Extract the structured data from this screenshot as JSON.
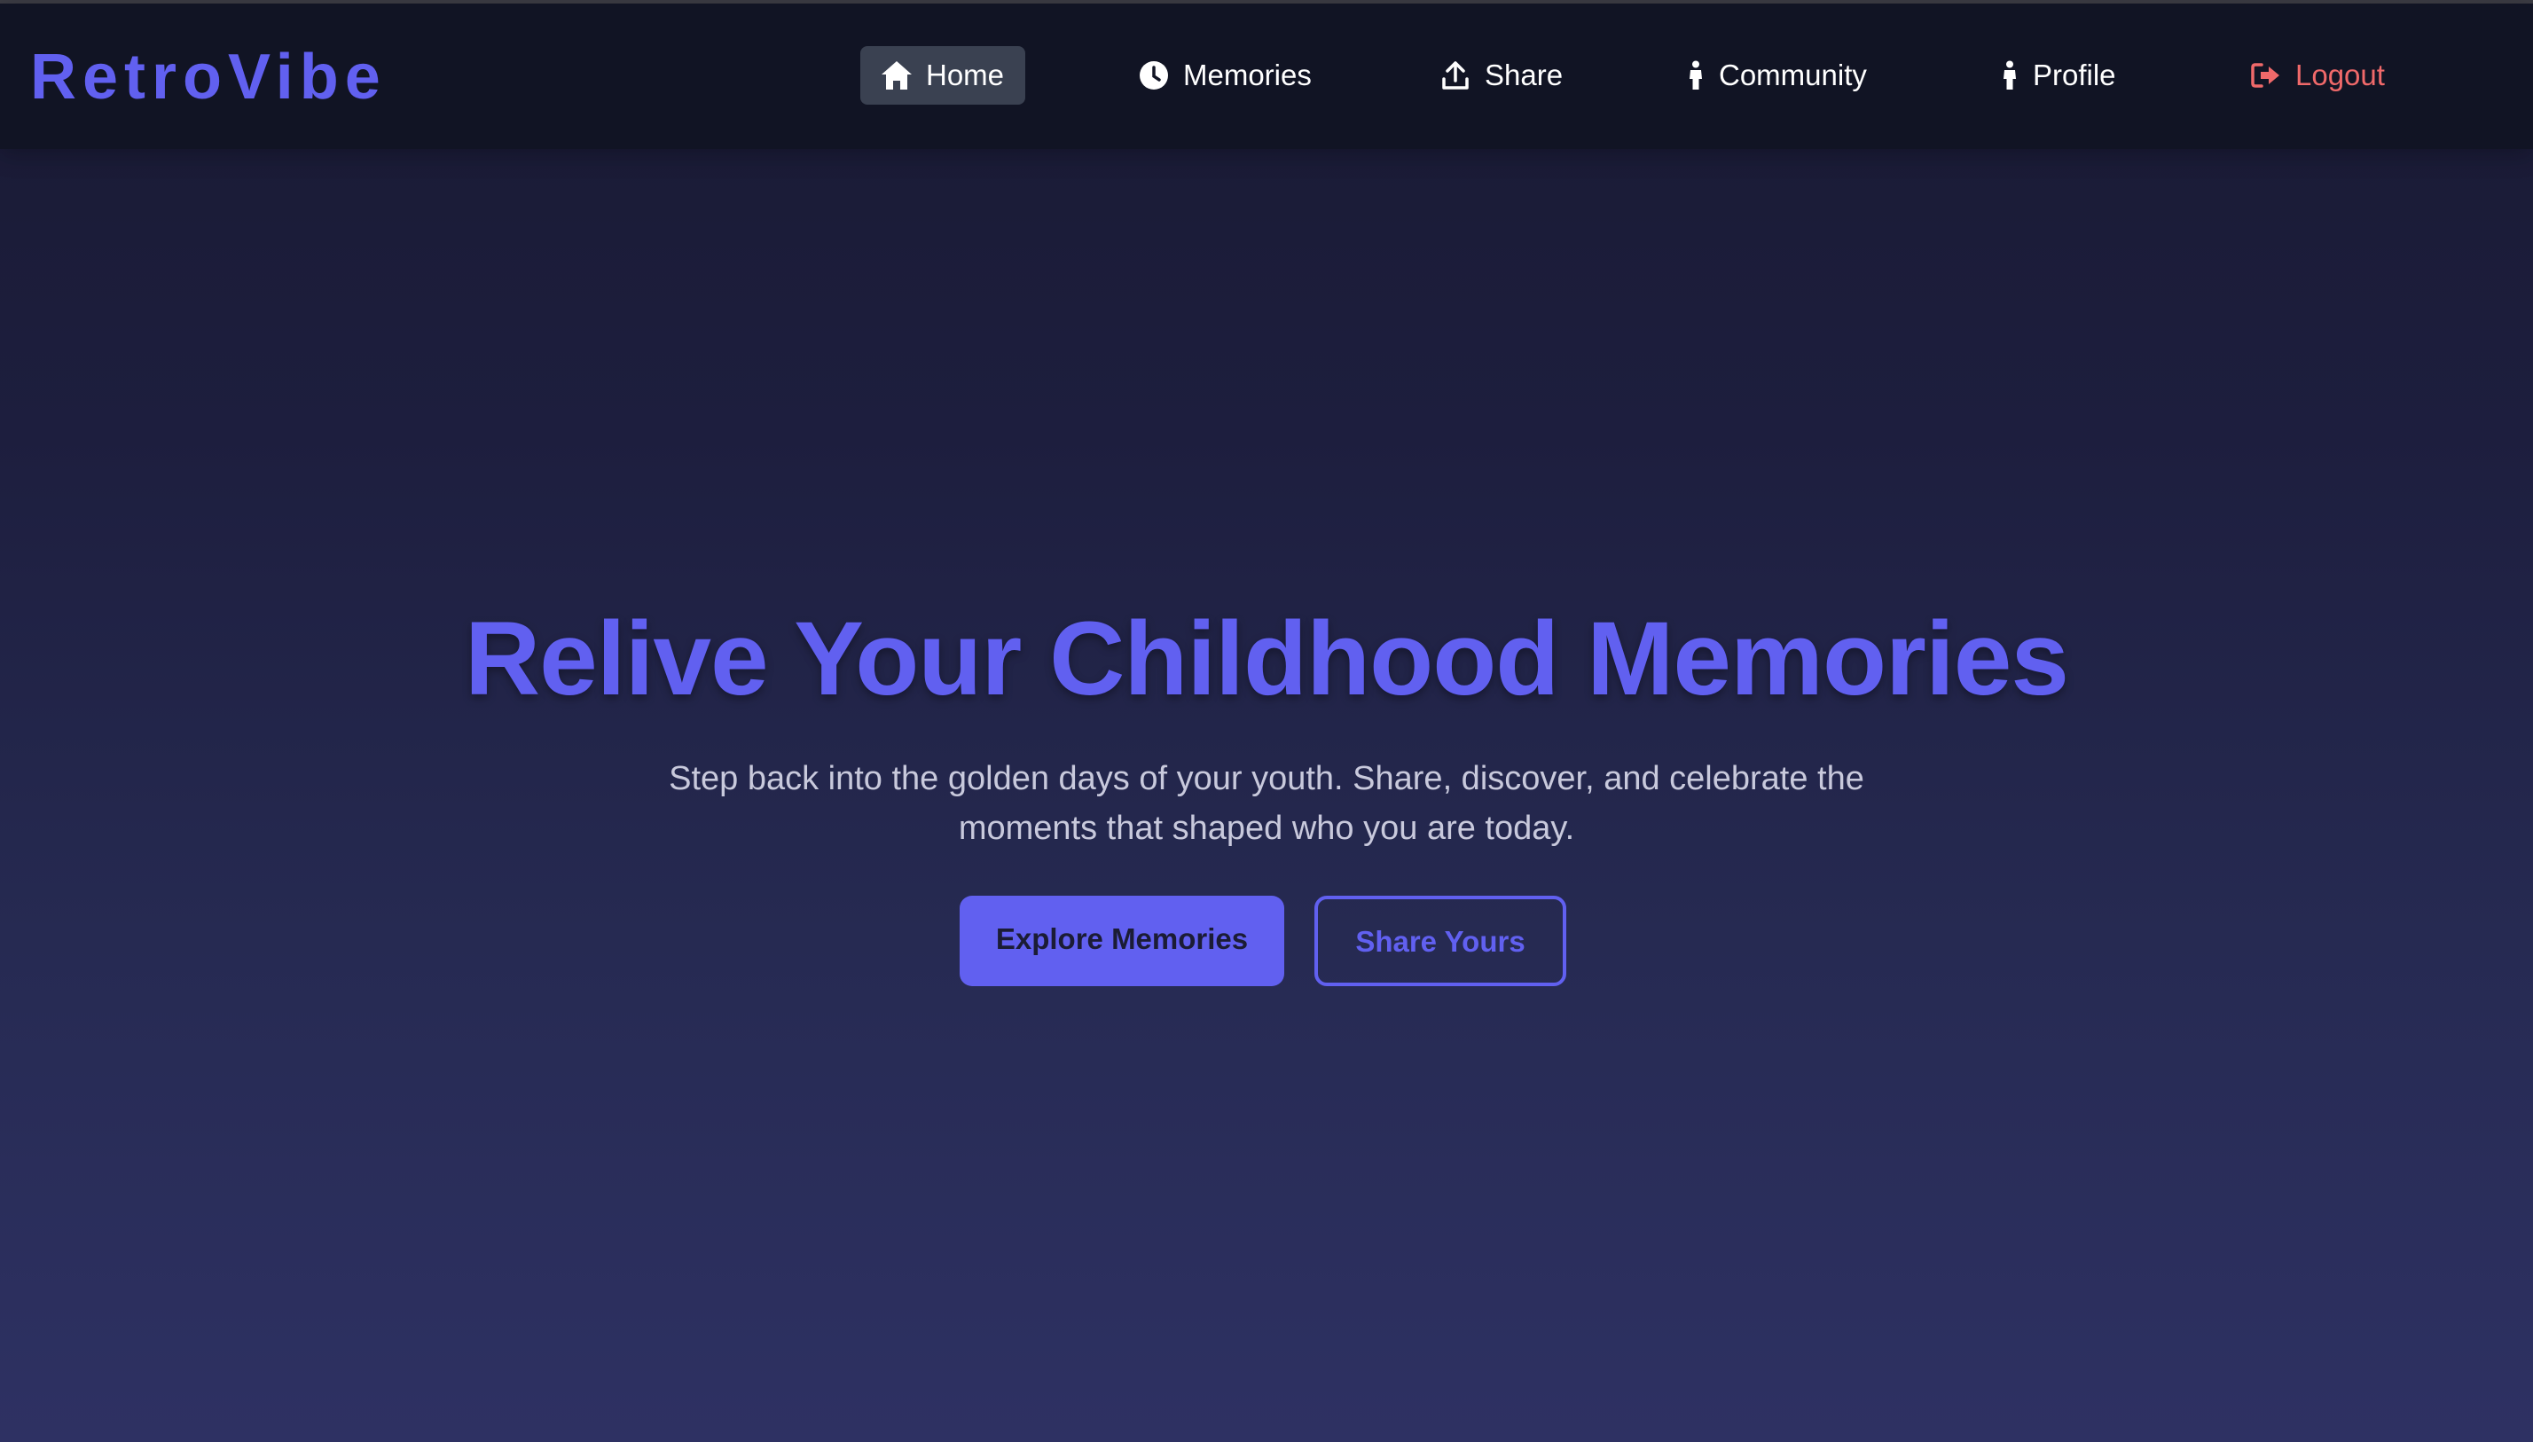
{
  "app": {
    "brand": "RetroVibe"
  },
  "nav": {
    "items": [
      {
        "label": "Home",
        "icon": "home-icon",
        "active": true
      },
      {
        "label": "Memories",
        "icon": "clock-icon",
        "active": false
      },
      {
        "label": "Share",
        "icon": "upload-icon",
        "active": false
      },
      {
        "label": "Community",
        "icon": "person-icon",
        "active": false
      },
      {
        "label": "Profile",
        "icon": "person-icon",
        "active": false
      },
      {
        "label": "Logout",
        "icon": "sign-out-icon",
        "active": false
      }
    ]
  },
  "hero": {
    "title": "Relive Your Childhood Memories",
    "subtitle": "Step back into the golden days of your youth. Share, discover, and celebrate the moments that shaped who you are today.",
    "primary_button": "Explore Memories",
    "secondary_button": "Share Yours"
  },
  "colors": {
    "accent": "#6160f0",
    "logout": "#f0696a",
    "navbar_bg": "#111424",
    "active_nav_bg": "#3a4151"
  }
}
